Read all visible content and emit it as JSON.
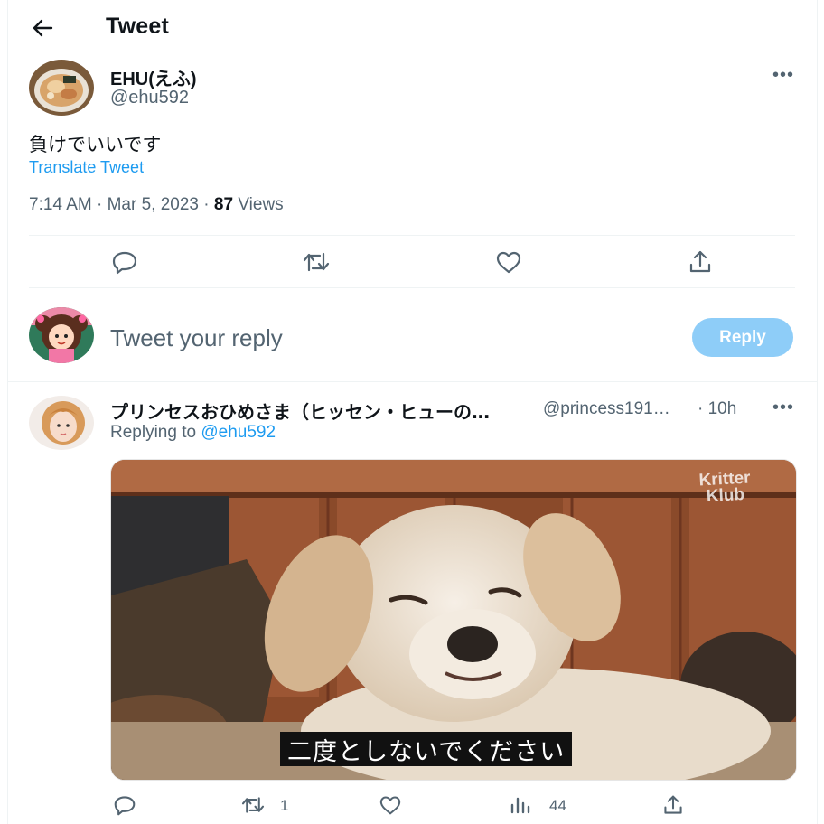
{
  "header": {
    "title": "Tweet",
    "back_icon": "arrow-left-icon"
  },
  "main_tweet": {
    "author_name": "EHU(えふ)",
    "author_handle": "@ehu592",
    "text": "負けでいいです",
    "translate_label": "Translate Tweet",
    "time": "7:14 AM",
    "date": "Mar 5, 2023",
    "views_count": "87",
    "views_label": "Views",
    "actions": [
      "reply-icon",
      "retweet-icon",
      "like-icon",
      "share-icon"
    ]
  },
  "composer": {
    "placeholder": "Tweet your reply",
    "button_label": "Reply",
    "button_color": "#8ecdf8"
  },
  "reply_tweet": {
    "author_name": "プリンセスおひめさま（ヒッセン・ヒューの…",
    "author_handle": "@princess191…",
    "time": "· 10h",
    "replying_prefix": "Replying to",
    "replying_handle": "@ehu592",
    "media_caption": "二度としないでください",
    "media_watermark_line1": "Kritter",
    "media_watermark_line2": "Klub",
    "retweet_count": "1",
    "views_count": "44"
  },
  "colors": {
    "accent": "#1d9bf0",
    "muted": "#536471",
    "text": "#0f1419"
  }
}
